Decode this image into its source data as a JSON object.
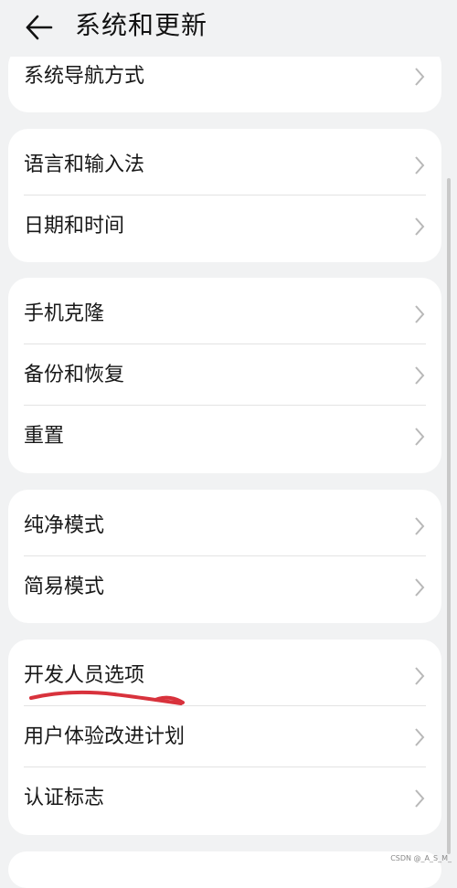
{
  "header": {
    "back_icon": "arrow-left-icon",
    "title": "系统和更新"
  },
  "groups": [
    {
      "items": [
        {
          "label": "系统导航方式"
        }
      ]
    },
    {
      "items": [
        {
          "label": "语言和输入法"
        },
        {
          "label": "日期和时间"
        }
      ]
    },
    {
      "items": [
        {
          "label": "手机克隆"
        },
        {
          "label": "备份和恢复"
        },
        {
          "label": "重置"
        }
      ]
    },
    {
      "items": [
        {
          "label": "纯净模式"
        },
        {
          "label": "简易模式"
        }
      ]
    },
    {
      "items": [
        {
          "label": "开发人员选项"
        },
        {
          "label": "用户体验改进计划"
        },
        {
          "label": "认证标志"
        }
      ]
    }
  ],
  "annotation": {
    "color": "#d8323c",
    "target": "开发人员选项"
  },
  "watermark": "CSDN @_A_S_M_",
  "colors": {
    "background": "#f1f2f3",
    "card": "#ffffff",
    "chevron": "#b8b8b8"
  }
}
